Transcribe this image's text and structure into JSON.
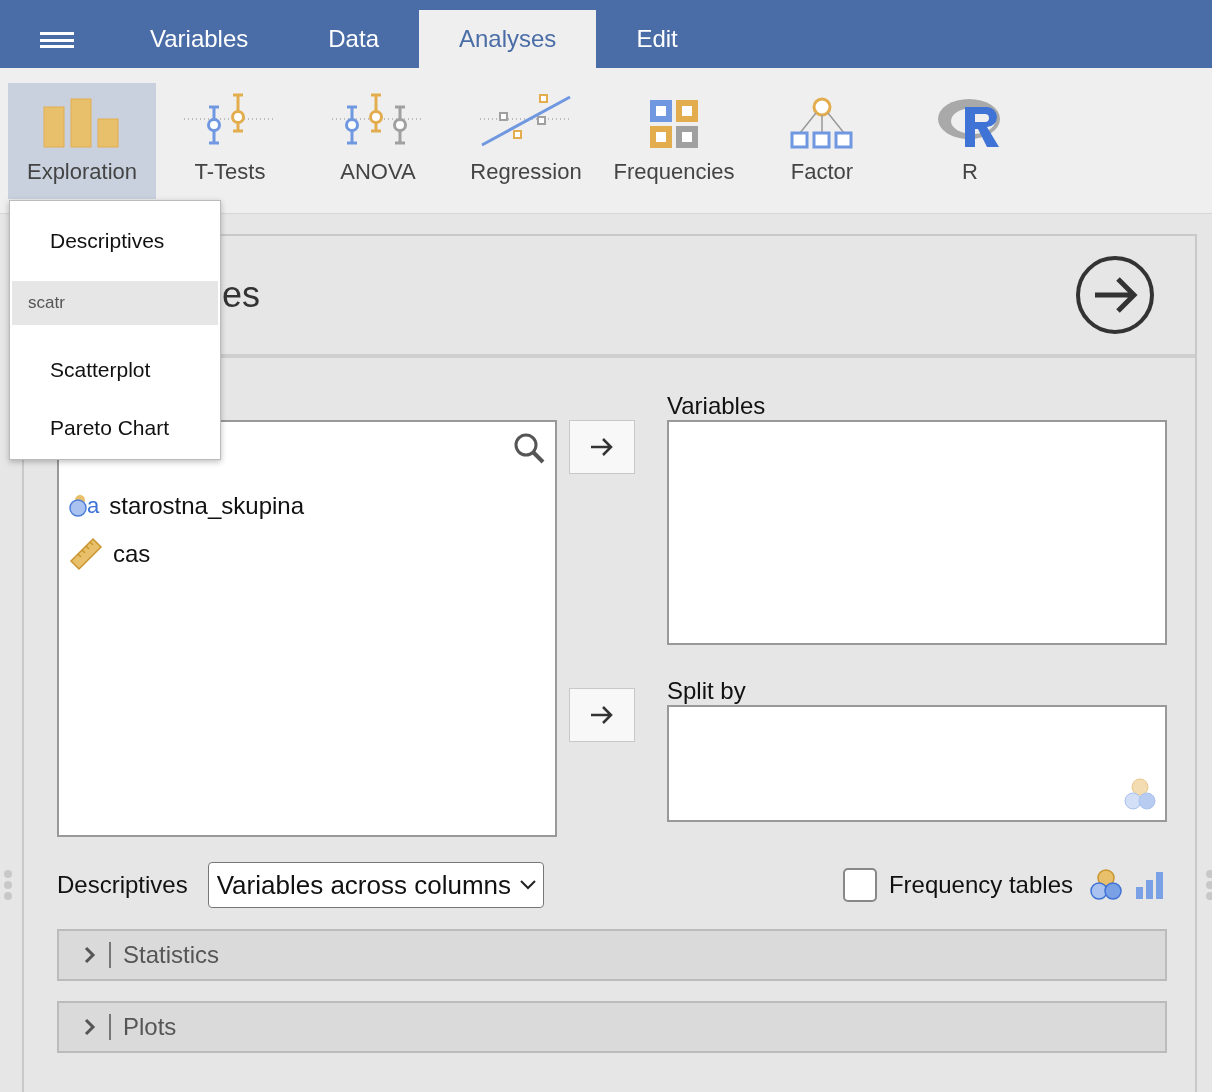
{
  "tabs": [
    {
      "label": "Variables",
      "selected": false
    },
    {
      "label": "Data",
      "selected": false
    },
    {
      "label": "Analyses",
      "selected": true
    },
    {
      "label": "Edit",
      "selected": false
    }
  ],
  "ribbon": [
    {
      "label": "Exploration",
      "selected": true
    },
    {
      "label": "T-Tests",
      "selected": false
    },
    {
      "label": "ANOVA",
      "selected": false
    },
    {
      "label": "Regression",
      "selected": false
    },
    {
      "label": "Frequencies",
      "selected": false
    },
    {
      "label": "Factor",
      "selected": false
    },
    {
      "label": "R",
      "selected": false
    }
  ],
  "menu": {
    "items": [
      {
        "kind": "item",
        "label": "Descriptives"
      },
      {
        "kind": "search",
        "value": "scatr"
      },
      {
        "kind": "item",
        "label": "Scatterplot"
      },
      {
        "kind": "item",
        "label": "Pareto Chart"
      }
    ]
  },
  "panel": {
    "title": "es",
    "variables": [
      {
        "kind": "nominal",
        "name": "starostna_skupina",
        "icon_letter": "a"
      },
      {
        "kind": "continuous",
        "name": "cas"
      }
    ],
    "targets": [
      {
        "label": "Variables"
      },
      {
        "label": "Split by"
      }
    ],
    "descriptives_label": "Descriptives",
    "descriptives_select": "Variables across columns",
    "frequency_tables": {
      "label": "Frequency tables",
      "checked": false
    },
    "sections": [
      {
        "label": "Statistics",
        "expanded": false
      },
      {
        "label": "Plots",
        "expanded": false
      }
    ]
  }
}
